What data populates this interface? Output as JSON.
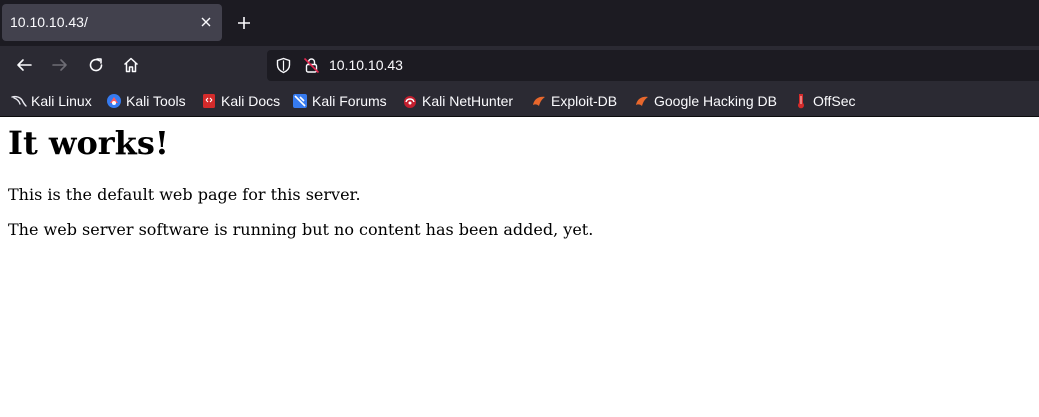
{
  "tab": {
    "title": "10.10.10.43/"
  },
  "urlbar": {
    "url": "10.10.10.43"
  },
  "bookmarks": [
    {
      "label": "Kali Linux",
      "icon": "kali-dragon-icon"
    },
    {
      "label": "Kali Tools",
      "icon": "kali-tools-icon"
    },
    {
      "label": "Kali Docs",
      "icon": "kali-docs-icon"
    },
    {
      "label": "Kali Forums",
      "icon": "kali-forums-icon"
    },
    {
      "label": "Kali NetHunter",
      "icon": "kali-nethunter-icon"
    },
    {
      "label": "Exploit-DB",
      "icon": "exploit-db-icon"
    },
    {
      "label": "Google Hacking DB",
      "icon": "google-hacking-db-icon"
    },
    {
      "label": "OffSec",
      "icon": "offsec-icon"
    }
  ],
  "page": {
    "heading": "It works!",
    "paragraphs": [
      "This is the default web page for this server.",
      "The web server software is running but no content has been added, yet."
    ]
  },
  "colors": {
    "tabstrip": "#1c1b22",
    "toolbar": "#2b2a33",
    "active_tab": "#42414d",
    "text_light": "#fbfbfe"
  }
}
